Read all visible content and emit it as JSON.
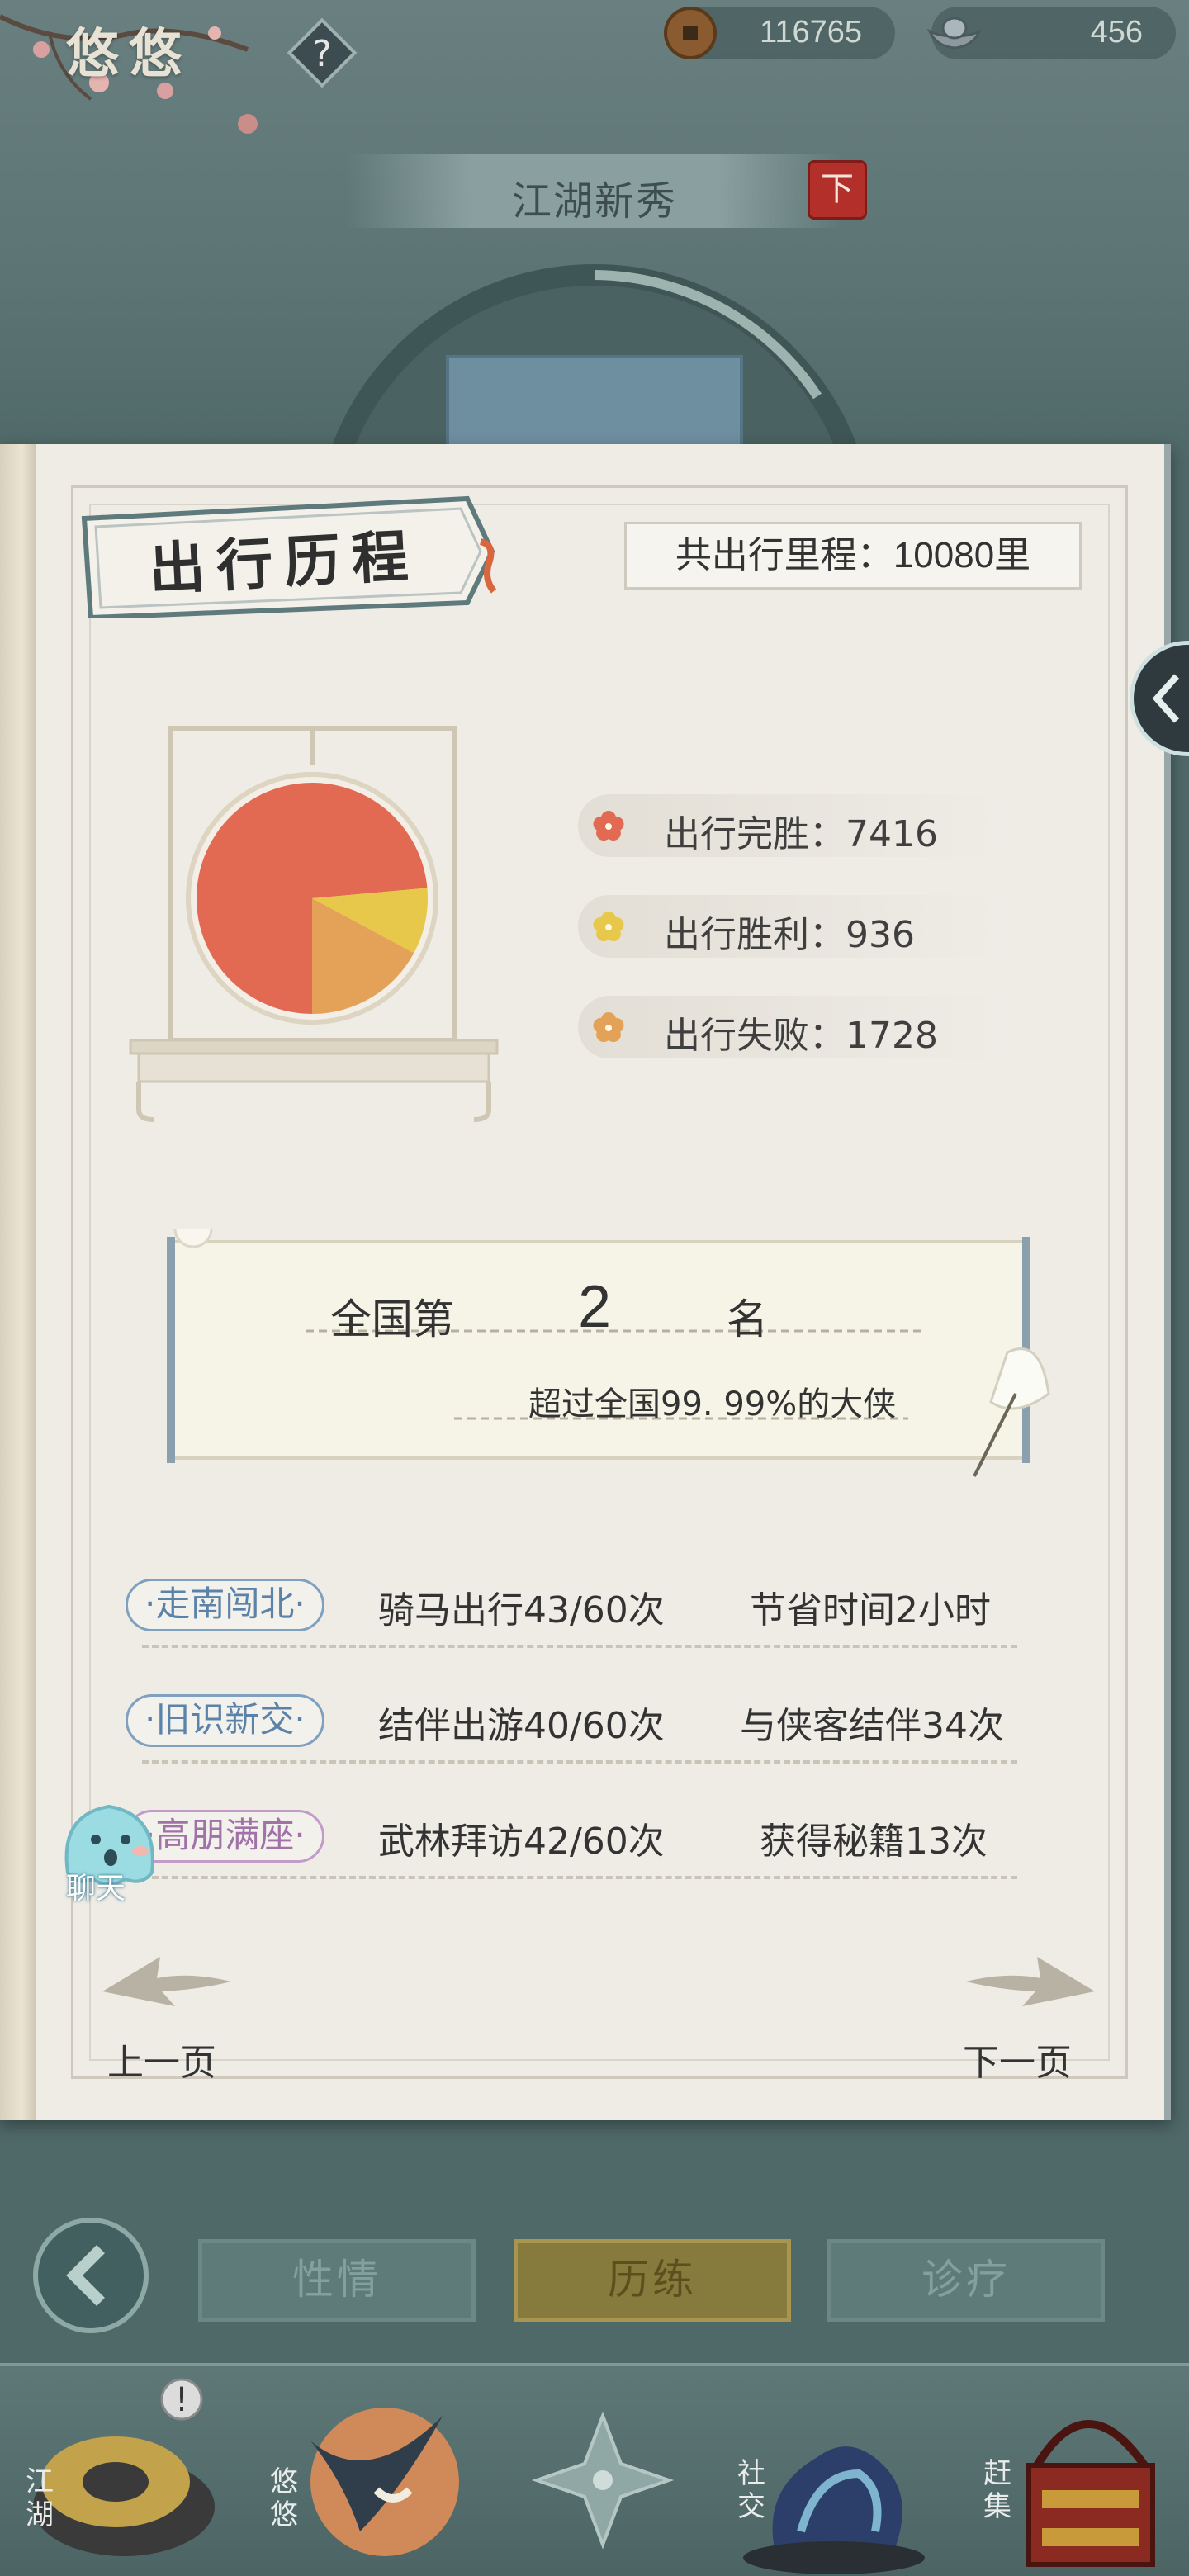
{
  "topbar": {
    "player_name": "悠悠",
    "help_glyph": "?",
    "coins": "116765",
    "ingots": "456"
  },
  "title": {
    "rank_title": "江湖新秀",
    "down_glyph": "下"
  },
  "book": {
    "section_title": "出行历程",
    "mileage_label": "共出行里程：",
    "mileage_value": "10080里",
    "legend": [
      {
        "label": "出行完胜：7416",
        "color": "#e36a52"
      },
      {
        "label": "出行胜利：936",
        "color": "#e8c84a"
      },
      {
        "label": "出行失败：1728",
        "color": "#e3a258"
      }
    ],
    "rank": {
      "prefix": "全国第",
      "number": "2",
      "suffix": "名",
      "subtitle": "超过全国99. 99%的大侠"
    },
    "stats": [
      {
        "badge": "·走南闯北·",
        "a": "骑马出行43/60次",
        "b": "节省时间2小时",
        "badge_color": "#5b82a8"
      },
      {
        "badge": "·旧识新交·",
        "a": "结伴出游40/60次",
        "b": "与侠客结伴34次",
        "badge_color": "#5b82a8"
      },
      {
        "badge": "·高朋满座·",
        "a": "武林拜访42/60次",
        "b": "获得秘籍13次",
        "badge_color": "#a072a8"
      }
    ],
    "prev_page": "上一页",
    "next_page": "下一页",
    "chat_label": "聊天"
  },
  "chart_data": {
    "type": "pie",
    "categories": [
      "出行完胜",
      "出行胜利",
      "出行失败"
    ],
    "values": [
      7416,
      936,
      1728
    ],
    "colors": [
      "#e36a52",
      "#e8c84a",
      "#e3a258"
    ]
  },
  "tabs": [
    {
      "label": "性情",
      "active": false
    },
    {
      "label": "历练",
      "active": true
    },
    {
      "label": "诊疗",
      "active": false
    }
  ],
  "bottom_nav": [
    {
      "label": "江湖"
    },
    {
      "label": "悠悠"
    },
    {
      "label": "社交"
    },
    {
      "label": "赶集"
    }
  ]
}
